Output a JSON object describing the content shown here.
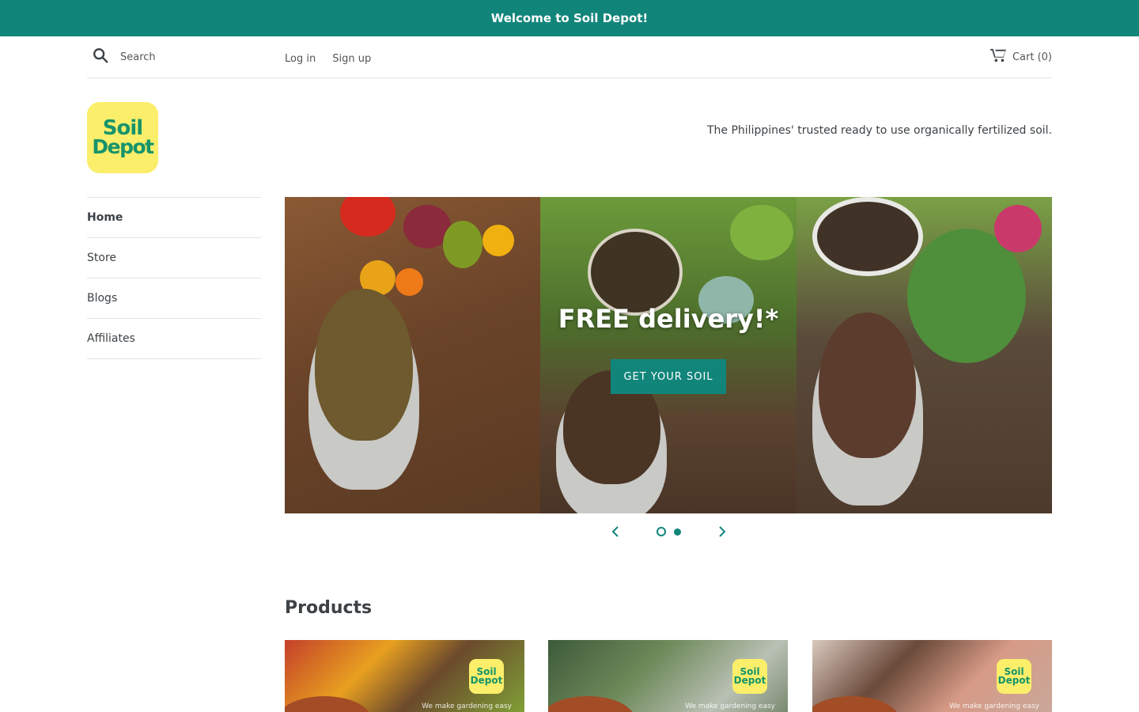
{
  "announcement": "Welcome to Soil Depot!",
  "topbar": {
    "search_placeholder": "Search",
    "login": "Log in",
    "signup": "Sign up",
    "cart": "Cart (0)"
  },
  "brand": {
    "logo_line1": "Soil",
    "logo_line2": "Depot",
    "tagline": "The Philippines' trusted ready to use organically fertilized soil."
  },
  "nav": {
    "items": [
      {
        "label": "Home",
        "active": true
      },
      {
        "label": "Store"
      },
      {
        "label": "Blogs"
      },
      {
        "label": "Affiliates"
      }
    ]
  },
  "hero": {
    "title": "FREE delivery!*",
    "button": "GET YOUR SOIL",
    "slide_count": 2,
    "current_slide": 1
  },
  "products": {
    "title": "Products",
    "items": [
      {
        "badge_line1": "Soil",
        "badge_line2": "Depot",
        "motto": "We make gardening easy"
      },
      {
        "badge_line1": "Soil",
        "badge_line2": "Depot",
        "motto": "We make gardening easy"
      },
      {
        "badge_line1": "Soil",
        "badge_line2": "Depot",
        "motto": "We make gardening easy"
      }
    ]
  },
  "colors": {
    "accent": "#12857b",
    "logo_bg": "#fbee6a",
    "logo_text": "#16946b"
  },
  "icons": [
    "search-icon",
    "cart-icon",
    "chevron-left-icon",
    "chevron-right-icon"
  ]
}
